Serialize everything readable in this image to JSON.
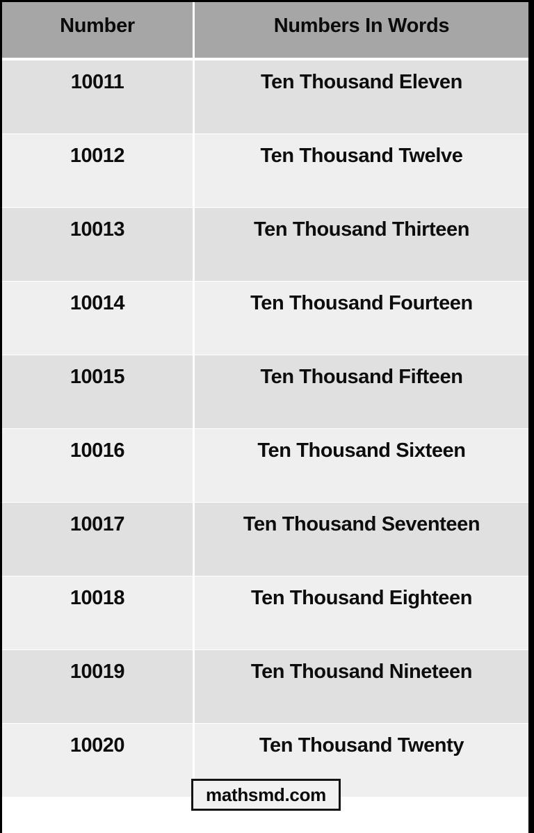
{
  "table": {
    "columns": [
      {
        "key": "number",
        "header": "Number"
      },
      {
        "key": "words",
        "header": "Numbers In Words"
      }
    ],
    "header_background": "#a6a6a6",
    "row_background_odd": "#e0e0e0",
    "row_background_even": "#efefef",
    "text_color": "#0d0d0d",
    "rows": [
      {
        "number": "10011",
        "words": "Ten Thousand Eleven"
      },
      {
        "number": "10012",
        "words": "Ten Thousand Twelve"
      },
      {
        "number": "10013",
        "words": "Ten Thousand Thirteen"
      },
      {
        "number": "10014",
        "words": "Ten Thousand Fourteen"
      },
      {
        "number": "10015",
        "words": "Ten Thousand Fifteen"
      },
      {
        "number": "10016",
        "words": "Ten Thousand Sixteen"
      },
      {
        "number": "10017",
        "words": "Ten Thousand Seventeen"
      },
      {
        "number": "10018",
        "words": "Ten Thousand Eighteen"
      },
      {
        "number": "10019",
        "words": "Ten Thousand Nineteen"
      },
      {
        "number": "10020",
        "words": "Ten Thousand Twenty"
      }
    ]
  },
  "watermark": {
    "label": "mathsmd.com",
    "border_color": "#141414",
    "background": "#f1f1f1"
  },
  "page": {
    "border_color": "#000000",
    "background": "#ffffff"
  }
}
